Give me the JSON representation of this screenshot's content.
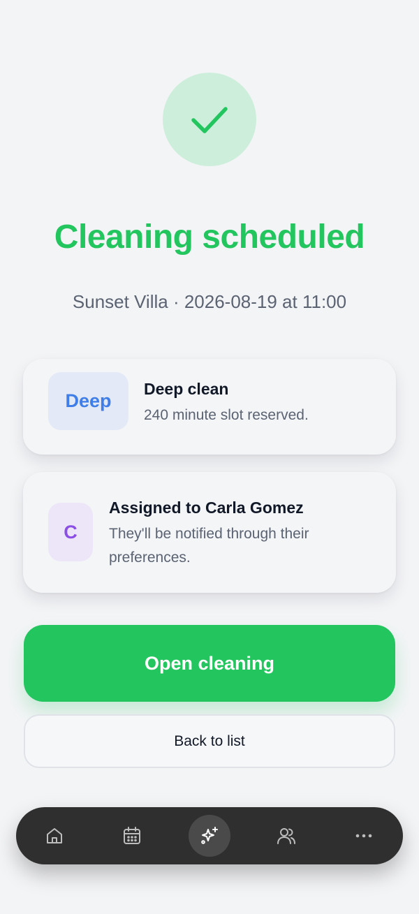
{
  "header": {
    "title": "Cleaning scheduled",
    "subtitle": "Sunset Villa · 2026-08-19 at 11:00"
  },
  "cards": [
    {
      "badge": "Deep",
      "title": "Deep clean",
      "description": "240 minute slot reserved."
    },
    {
      "badge": "C",
      "title": "Assigned to Carla Gomez",
      "description": "They'll be notified through their preferences."
    }
  ],
  "actions": {
    "primary_label": "Open cleaning",
    "secondary_label": "Back to list"
  },
  "tabbar": {
    "items": [
      {
        "icon": "home-icon"
      },
      {
        "icon": "calendar-icon"
      },
      {
        "icon": "sparkles-icon",
        "active": true
      },
      {
        "icon": "users-icon"
      },
      {
        "icon": "more-icon"
      }
    ]
  },
  "colors": {
    "accent": "#22c55e",
    "title": "#22c55e",
    "check_bg": "#cdeedb",
    "deep_badge_text": "#3f7ee8",
    "assignee_badge_text": "#8b4fe6",
    "tabbar_bg": "#2f2f2f"
  }
}
